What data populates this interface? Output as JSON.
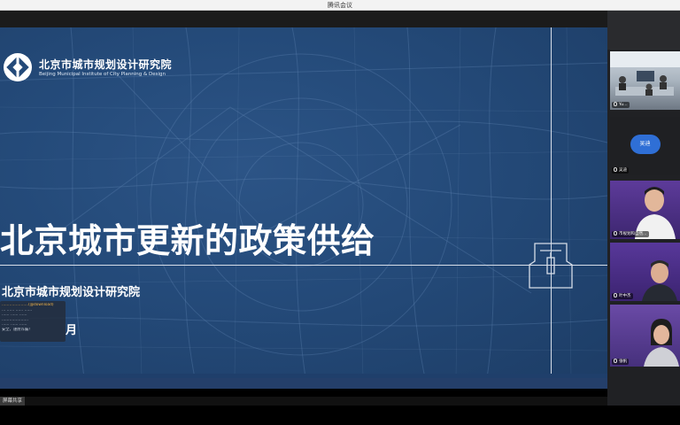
{
  "window": {
    "title": "腾讯会议"
  },
  "slide": {
    "logo_cn": "北京市城市规划设计研究院",
    "logo_en": "Beijing Municipal Institute of City Planning & Design",
    "title": "北京城市更新的政策供给",
    "organization": "北京市城市规划设计研究院",
    "date_suffix": "月",
    "notice_lines": [
      "…………………(@download)",
      "… …… …… ……",
      "…… …… ……",
      "…………………",
      "…… …… ……",
      "安全，谨防诈骗！"
    ]
  },
  "participants": [
    {
      "name": "Yu…",
      "kind": "video"
    },
    {
      "name": "吴迪",
      "avatar_text": "吴迪",
      "kind": "avatar"
    },
    {
      "name": "市规划和自然…",
      "kind": "video"
    },
    {
      "name": "叶中杰",
      "kind": "video"
    },
    {
      "name": "张帆",
      "kind": "video"
    }
  ],
  "status": {
    "share_label": "屏幕共享"
  },
  "colors": {
    "accent": "#2f6fd6",
    "slide_bg": "#244a79"
  }
}
